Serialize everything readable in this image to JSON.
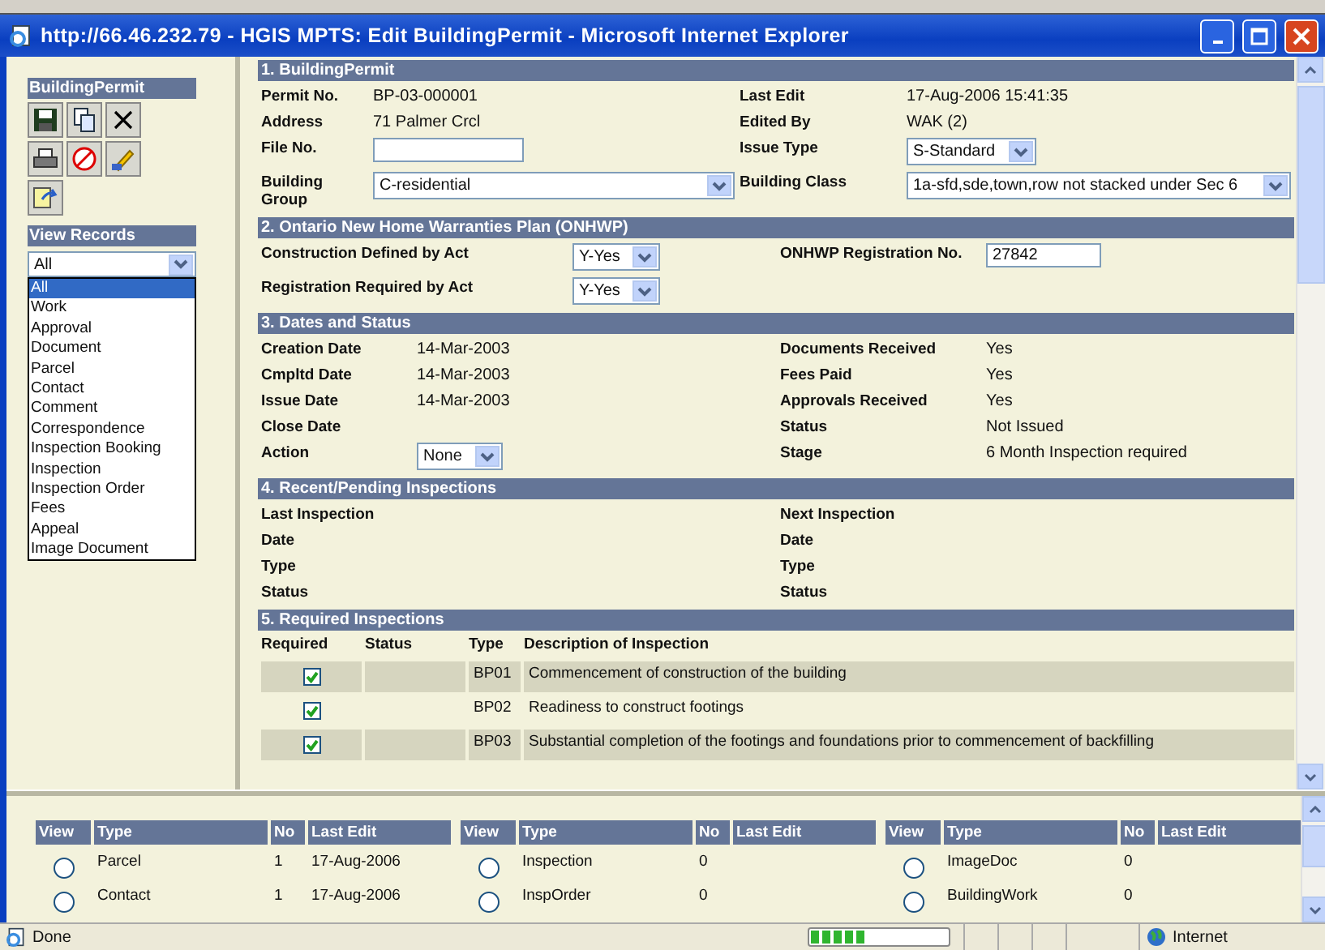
{
  "window": {
    "title": "http://66.46.232.79 - HGIS MPTS: Edit BuildingPermit - Microsoft Internet Explorer"
  },
  "sidebar": {
    "title": "BuildingPermit",
    "view_records": {
      "title": "View Records",
      "value": "All",
      "options": [
        {
          "label": "All",
          "selected": true
        },
        {
          "label": "Work",
          "selected": false
        },
        {
          "label": "Approval",
          "selected": false
        },
        {
          "label": "Document",
          "selected": false
        },
        {
          "label": "Parcel",
          "selected": false
        },
        {
          "label": "Contact",
          "selected": false
        },
        {
          "label": "Comment",
          "selected": false
        },
        {
          "label": "Correspondence",
          "selected": false
        },
        {
          "label": "Inspection Booking",
          "selected": false
        },
        {
          "label": "Inspection",
          "selected": false
        },
        {
          "label": "Inspection Order",
          "selected": false
        },
        {
          "label": "Fees",
          "selected": false
        },
        {
          "label": "Appeal",
          "selected": false
        },
        {
          "label": "Image Document",
          "selected": false
        }
      ]
    }
  },
  "sections": [
    {
      "kind": "permit",
      "title": "1. BuildingPermit",
      "rows": [
        [
          {
            "label": "Permit No.",
            "kind": "text",
            "value": "BP-03-000001"
          },
          {
            "label": "Last Edit",
            "kind": "text",
            "value": "17-Aug-2006 15:41:35"
          }
        ],
        [
          {
            "label": "Address",
            "kind": "text",
            "value": "71 Palmer Crcl"
          },
          {
            "label": "Edited By",
            "kind": "text",
            "value": "WAK (2)"
          }
        ],
        [
          {
            "label": "File No.",
            "kind": "input"
          },
          {
            "label": "Issue Type",
            "kind": "select",
            "value": "S-Standard"
          }
        ],
        [
          {
            "label": "Building Group",
            "kind": "select",
            "value": "C-residential"
          },
          {
            "label": "Building Class",
            "kind": "select",
            "value": "1a-sfd,sde,town,row not stacked under Sec 6"
          }
        ]
      ]
    },
    {
      "kind": "act",
      "title": "2. Ontario New Home Warranties Plan (ONHWP)",
      "rows": [
        [
          {
            "label": "Construction Defined by Act",
            "kind": "select",
            "value": "Y-Yes"
          },
          {
            "label": "ONHWP Registration No.",
            "kind": "input",
            "value": "27842"
          }
        ],
        [
          {
            "label": "Registration Required by Act",
            "kind": "select",
            "value": "Y-Yes"
          }
        ]
      ]
    },
    {
      "kind": "dates",
      "title": "3. Dates and Status",
      "rows": [
        [
          {
            "label": "Creation Date",
            "kind": "text",
            "value": "14-Mar-2003"
          },
          {
            "label": "Documents Received",
            "kind": "text",
            "value": "Yes"
          }
        ],
        [
          {
            "label": "Cmpltd Date",
            "kind": "text",
            "value": "14-Mar-2003"
          },
          {
            "label": "Fees Paid",
            "kind": "text",
            "value": "Yes"
          }
        ],
        [
          {
            "label": "Issue Date",
            "kind": "text",
            "value": "14-Mar-2003"
          },
          {
            "label": "Approvals Received",
            "kind": "text",
            "value": "Yes"
          }
        ],
        [
          {
            "label": "Close Date",
            "kind": "text"
          },
          {
            "label": "Status",
            "kind": "text",
            "value": "Not Issued"
          }
        ],
        [
          {
            "label": "Action",
            "kind": "select",
            "value": "None"
          },
          {
            "label": "Stage",
            "kind": "text",
            "value": "6 Month Inspection required"
          }
        ]
      ]
    },
    {
      "kind": "pending",
      "title": "4. Recent/Pending Inspections",
      "rows": [
        [
          {
            "label": "Last Inspection",
            "kind": "label"
          },
          {
            "label": "Next Inspection",
            "kind": "label"
          }
        ],
        [
          {
            "label": "Date",
            "kind": "label"
          },
          {
            "label": "Date",
            "kind": "label"
          }
        ],
        [
          {
            "label": "Type",
            "kind": "label"
          },
          {
            "label": "Type",
            "kind": "label"
          }
        ],
        [
          {
            "label": "Status",
            "kind": "label"
          },
          {
            "label": "Status",
            "kind": "label"
          }
        ]
      ]
    }
  ],
  "required_inspections": {
    "title": "5. Required Inspections",
    "columns": [
      "Required",
      "Status",
      "Type",
      "Description of Inspection"
    ],
    "rows": [
      {
        "checked": true,
        "type": "BP01",
        "description": "Commencement of construction of the building"
      },
      {
        "checked": true,
        "type": "BP02",
        "description": "Readiness to construct footings"
      },
      {
        "checked": true,
        "type": "BP03",
        "description": "Substantial completion of the footings and foundations prior to commencement of backfilling"
      }
    ]
  },
  "records_tables": [
    {
      "columns": [
        "View",
        "Type",
        "No",
        "Last Edit"
      ],
      "rows": [
        {
          "selected": false,
          "type": "Parcel",
          "no": "1",
          "last_edit": "17-Aug-2006"
        },
        {
          "selected": false,
          "type": "Contact",
          "no": "1",
          "last_edit": "17-Aug-2006"
        }
      ]
    },
    {
      "columns": [
        "View",
        "Type",
        "No",
        "Last Edit"
      ],
      "rows": [
        {
          "selected": false,
          "type": "Inspection",
          "no": "0"
        },
        {
          "selected": false,
          "type": "InspOrder",
          "no": "0"
        }
      ]
    },
    {
      "columns": [
        "View",
        "Type",
        "No",
        "Last Edit"
      ],
      "rows": [
        {
          "selected": false,
          "type": "ImageDoc",
          "no": "0"
        },
        {
          "selected": false,
          "type": "BuildingWork",
          "no": "0"
        }
      ]
    }
  ],
  "status_bar": {
    "text": "Done",
    "progress": {
      "level": 0.42
    },
    "zone": "Internet"
  }
}
